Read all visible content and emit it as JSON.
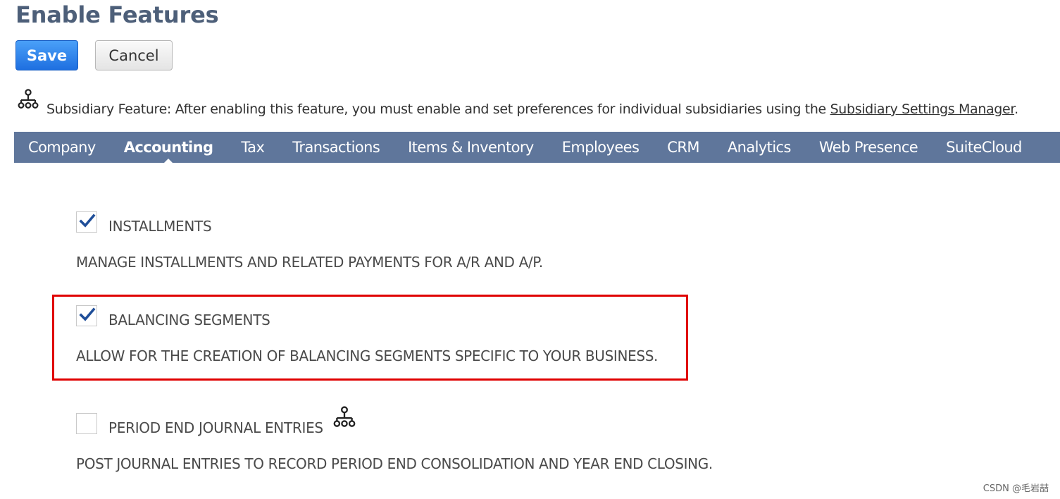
{
  "page": {
    "title": "Enable Features"
  },
  "toolbar": {
    "save_label": "Save",
    "cancel_label": "Cancel"
  },
  "subsidiary_note": {
    "icon": "subsidiary-hierarchy-icon",
    "text": "Subsidiary Feature: After enabling this feature, you must enable and set preferences for individual subsidiaries using the ",
    "link_text": "Subsidiary Settings Manager",
    "suffix": "."
  },
  "tabs": [
    {
      "label": "Company",
      "active": false
    },
    {
      "label": "Accounting",
      "active": true
    },
    {
      "label": "Tax",
      "active": false
    },
    {
      "label": "Transactions",
      "active": false
    },
    {
      "label": "Items & Inventory",
      "active": false
    },
    {
      "label": "Employees",
      "active": false
    },
    {
      "label": "CRM",
      "active": false
    },
    {
      "label": "Analytics",
      "active": false
    },
    {
      "label": "Web Presence",
      "active": false
    },
    {
      "label": "SuiteCloud",
      "active": false
    }
  ],
  "features": [
    {
      "label": "INSTALLMENTS",
      "description": "MANAGE INSTALLMENTS AND RELATED PAYMENTS FOR A/R AND A/P.",
      "checked": true
    },
    {
      "label": "BALANCING SEGMENTS",
      "description": "ALLOW FOR THE CREATION OF BALANCING SEGMENTS SPECIFIC TO YOUR BUSINESS.",
      "checked": true,
      "highlighted": true
    },
    {
      "label": "PERIOD END JOURNAL ENTRIES",
      "description": "POST JOURNAL ENTRIES TO RECORD PERIOD END CONSOLIDATION AND YEAR END CLOSING.",
      "checked": false,
      "subsidiary_icon": true
    }
  ],
  "watermark": "CSDN @毛岩喆",
  "colors": {
    "title": "#4d5f79",
    "tabbar_bg": "#5f769b",
    "save_button": "#2f86ec",
    "checkmark": "#1f4e99",
    "highlight": "#e00000"
  }
}
